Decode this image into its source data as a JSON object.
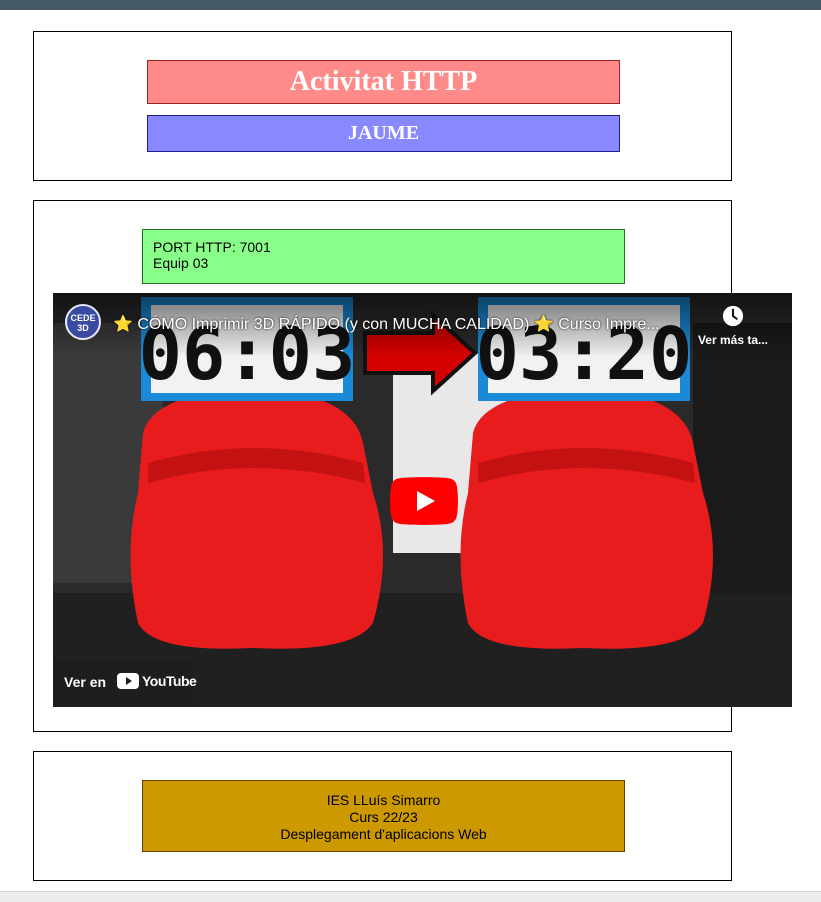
{
  "header": {
    "title": "Activitat HTTP",
    "name": "JAUME"
  },
  "server_info": {
    "port_line": "PORT HTTP: 7001",
    "team_line": "Equip 03"
  },
  "video": {
    "title_star_left": "⭐",
    "title_text": "CÓMO Imprimir 3D RÁPIDO (y con MUCHA CALIDAD)",
    "title_star_right": "⭐",
    "title_suffix": "Curso Impre...",
    "channel_initials": "CEDE 3D",
    "watch_later_label": "Ver más ta...",
    "watch_on_label": "Ver en",
    "youtube_label": "YouTube",
    "time_before": "06:03",
    "time_after": "03:20"
  },
  "footer": {
    "school": "IES LLuís Simarro",
    "course": "Curs 22/23",
    "subject": "Desplegament d'aplicacions Web"
  },
  "colors": {
    "title_bg": "#ff8a8a",
    "name_bg": "#8888ff",
    "info_bg": "#88ff88",
    "footer_bg": "#cc9900",
    "topbar": "#455a64"
  }
}
